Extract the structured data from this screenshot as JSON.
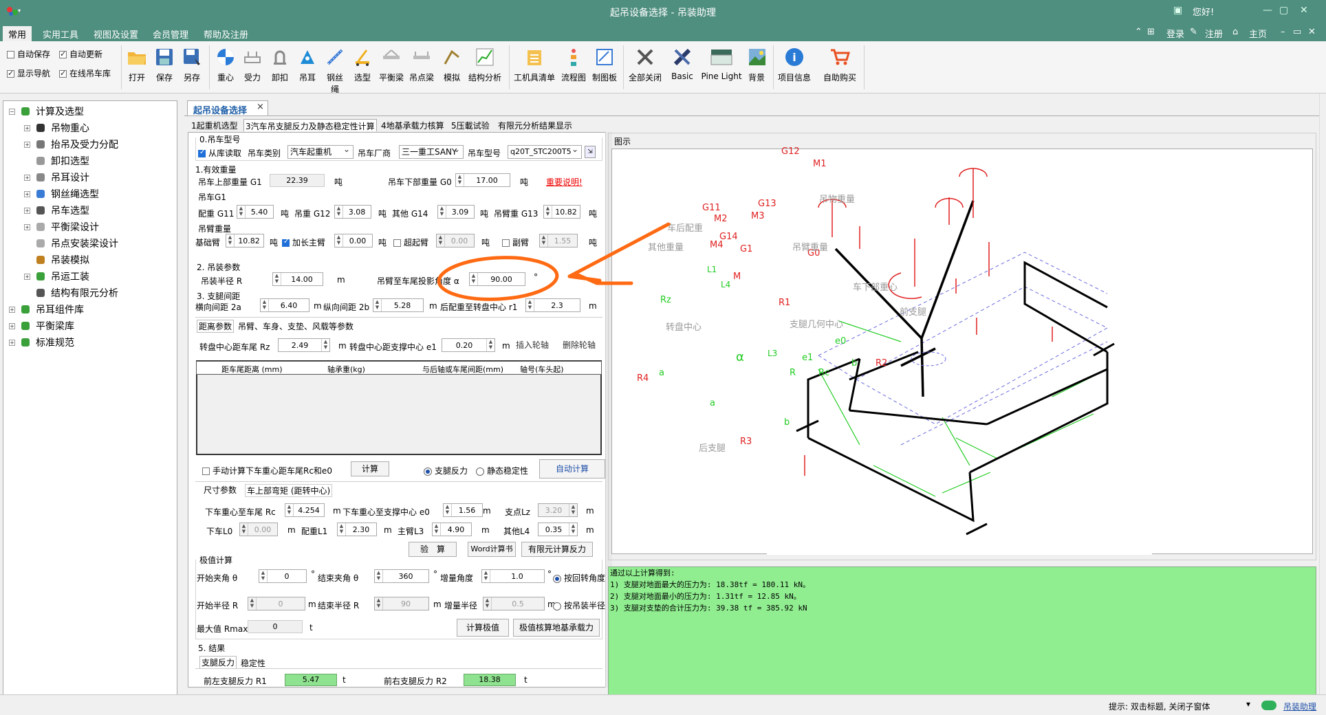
{
  "window": {
    "title": "起吊设备选择 - 吊装助理",
    "greeting": "您好!"
  },
  "menu": {
    "tabs": [
      "常用",
      "实用工具",
      "视图及设置",
      "会员管理",
      "帮助及注册"
    ],
    "right": {
      "login": "登录",
      "logout": "注册",
      "home": "主页"
    }
  },
  "ribbon": {
    "checks": [
      {
        "label": "自动保存",
        "checked": false
      },
      {
        "label": "自动更新",
        "checked": true
      },
      {
        "label": "显示导航",
        "checked": true
      },
      {
        "label": "在线吊车库",
        "checked": true
      }
    ],
    "buttons": [
      "打开",
      "保存",
      "另存",
      "重心",
      "受力",
      "卸扣",
      "吊耳",
      "钢丝绳",
      "选型",
      "平衡梁",
      "吊点梁",
      "模拟",
      "结构分析",
      "工机具清单",
      "流程图",
      "制图板",
      "全部关闭",
      "Basic",
      "Pine Light",
      "背景",
      "项目信息",
      "自助购买"
    ]
  },
  "tree": {
    "items": [
      {
        "label": "计算及选型",
        "level": 0,
        "icon": "puzzle-icon"
      },
      {
        "label": "吊物重心",
        "level": 1,
        "icon": "center-icon"
      },
      {
        "label": "抬吊及受力分配",
        "level": 1,
        "icon": "lift-icon"
      },
      {
        "label": "卸扣选型",
        "level": 1,
        "icon": "shackle-icon"
      },
      {
        "label": "吊耳设计",
        "level": 1,
        "icon": "lug-icon"
      },
      {
        "label": "钢丝绳选型",
        "level": 1,
        "icon": "rope-icon"
      },
      {
        "label": "吊车选型",
        "level": 1,
        "icon": "crane-icon"
      },
      {
        "label": "平衡梁设计",
        "level": 1,
        "icon": "beam-icon"
      },
      {
        "label": "吊点安装梁设计",
        "level": 1,
        "icon": "beam-icon"
      },
      {
        "label": "吊装模拟",
        "level": 1,
        "icon": "sim-icon"
      },
      {
        "label": "吊运工装",
        "level": 1,
        "icon": "puzzle-icon"
      },
      {
        "label": "结构有限元分析",
        "level": 1,
        "icon": "fem-icon"
      },
      {
        "label": "吊耳组件库",
        "level": 0,
        "icon": "puzzle-icon"
      },
      {
        "label": "平衡梁库",
        "level": 0,
        "icon": "puzzle-icon"
      },
      {
        "label": "标准规范",
        "level": 0,
        "icon": "puzzle-icon"
      }
    ]
  },
  "doc_tab": {
    "label": "起吊设备选择",
    "close": "×"
  },
  "sub_tabs": [
    "1起重机选型",
    "3汽车吊支腿反力及静态稳定性计算",
    "4地基承载力核算",
    "5压載试验",
    "有限元分析结果显示"
  ],
  "form": {
    "s0": {
      "title": "0.吊车型号",
      "from_lib": "从库读取",
      "type_label": "吊车类别",
      "type_value": "汽车起重机",
      "maker_label": "吊车厂商",
      "maker_value": "三一重工SANY",
      "model_label": "吊车型号",
      "model_value": "q20T_STC200T5"
    },
    "s1": {
      "title": "1.有效重量",
      "upper_label": "吊车上部重量 G1",
      "upper_value": "22.39",
      "lower_label": "吊车下部重量 G0",
      "lower_value": "17.00",
      "unit": "吨",
      "important": "重要说明!",
      "g1_title": "吊车G1",
      "cw_label": "配重 G11",
      "cw": "5.40",
      "hook_label": "吊重 G12",
      "hook": "3.08",
      "other_label": "其他 G14",
      "other": "3.09",
      "boom_label": "吊臂重 G13",
      "boom": "10.82",
      "arm_title": "吊臂重量",
      "base_label": "基础臂",
      "base": "10.82",
      "ext_label": "加长主臂",
      "ext": "0.00",
      "super_label": "超起臂",
      "super": "0.00",
      "jib_label": "副臂",
      "jib": "1.55"
    },
    "s2": {
      "title": "2. 吊装参数",
      "radius_label": "吊装半径 R",
      "radius": "14.00",
      "radius_unit": "m",
      "angle_label": "吊臂至车尾投影角度 α",
      "angle": "90.00",
      "angle_unit": "°"
    },
    "s3": {
      "title": "3. 支腿间距",
      "a_label": "横向间距 2a",
      "a": "6.40",
      "b_label": "纵向间距 2b",
      "b": "5.28",
      "r1_label": "后配重至转盘中心 r1",
      "r1": "2.3",
      "m": "m"
    },
    "inner_tabs": [
      "距离参数",
      "吊臂、车身、支垫、风载等参数"
    ],
    "rz_label": "转盘中心距车尾 Rz",
    "rz": "2.49",
    "e1_label": "转盘中心距支撑中心 e1",
    "e1": "0.20",
    "insert_btn": "插入轮轴",
    "delete_btn": "删除轮轴",
    "grid_headers": [
      "距车尾距离 (mm)",
      "轴承重(kg)",
      "与后轴或车尾间距(mm)",
      "轴号(车头起)"
    ],
    "manual_label": "手动计算下车重心距车尾Rc和e0",
    "calc_btn": "计算",
    "radio_reaction": "支腿反力",
    "radio_static": "静态稳定性",
    "auto_btn": "自动计算",
    "size_tabs": [
      "尺寸参数",
      "车上部弯矩 (距转中心)"
    ],
    "rc_label": "下车重心至车尾 Rc",
    "rc": "4.254",
    "e0_label": "下车重心至支撑中心 e0",
    "e0": "1.56",
    "lz_label": "支点Lz",
    "lz": "3.20",
    "l0_label": "下车L0",
    "l0": "0.00",
    "l1_label": "配重L1",
    "l1": "2.30",
    "l3_label": "主臂L3",
    "l3": "4.90",
    "l4_label": "其他L4",
    "l4": "0.35",
    "verify_btn": "验　算",
    "word_btn": "Word计算书",
    "fem_btn": "有限元计算反力",
    "extreme": {
      "title": "极值计算",
      "start_angle_label": "开始夹角 θ",
      "start_angle": "0",
      "end_angle_label": "结束夹角 θ",
      "end_angle": "360",
      "step_angle_label": "增量角度",
      "step_angle": "1.0",
      "by_angle": "按回转角度",
      "start_r_label": "开始半径 R",
      "start_r": "0",
      "end_r_label": "结束半径 R",
      "end_r": "90",
      "step_r_label": "增量半径",
      "step_r": "0.5",
      "by_radius": "按吊装半径",
      "max_label": "最大值 Rmax",
      "max": "0",
      "t": "t",
      "calc_btn": "计算极值",
      "check_btn": "极值核算地基承载力"
    },
    "s5": {
      "title": "5. 结果",
      "tabs": [
        "支腿反力",
        "稳定性"
      ],
      "r1_label": "前左支腿反力 R1",
      "r1": "5.47",
      "r2_label": "前右支腿反力 R2",
      "r2": "18.38",
      "t": "t"
    }
  },
  "diagram": {
    "label": "图示",
    "labels": {
      "G12": "G12",
      "M1": "M1",
      "load": "吊物重量",
      "G11": "G11",
      "M2": "M2",
      "G13": "G13",
      "M3": "M3",
      "cw": "车后配重",
      "G14": "G14",
      "M4": "M4",
      "G1": "G1",
      "G0": "G0",
      "boomw": "吊臂重量",
      "other": "其他重量",
      "M": "M",
      "lower": "车下部重心",
      "R1": "R1",
      "front": "前支腿",
      "turn": "转盘中心",
      "geo": "支腿几何中心",
      "Rz": "Rz",
      "alpha": "α",
      "R4": "R4",
      "R2": "R2",
      "R3": "R3",
      "rear": "后支腿",
      "a": "a",
      "b": "b",
      "e0": "e0",
      "e1": "e1",
      "Rc": "Rc",
      "R": "R",
      "L1": "L1",
      "L4": "L4",
      "L3": "L3"
    }
  },
  "results": [
    "通过以上计算得到:",
    "1) 支腿对地面最大的压力为: 18.38tf = 180.11 kN。",
    "2) 支腿对地面最小的压力为: 1.31tf = 12.85 kN。",
    "3) 支腿对支垫的合计压力为: 39.38 tf = 385.92 kN"
  ],
  "status": {
    "hint": "提示: 双击标题, 关闭子窗体",
    "link": "吊装助理"
  },
  "colors": {
    "title_bg": "#4f8f7f",
    "result_bg": "#90ee90",
    "annotation": "#ff6a13",
    "force": "#e02020",
    "dimension": "#22cc22"
  }
}
